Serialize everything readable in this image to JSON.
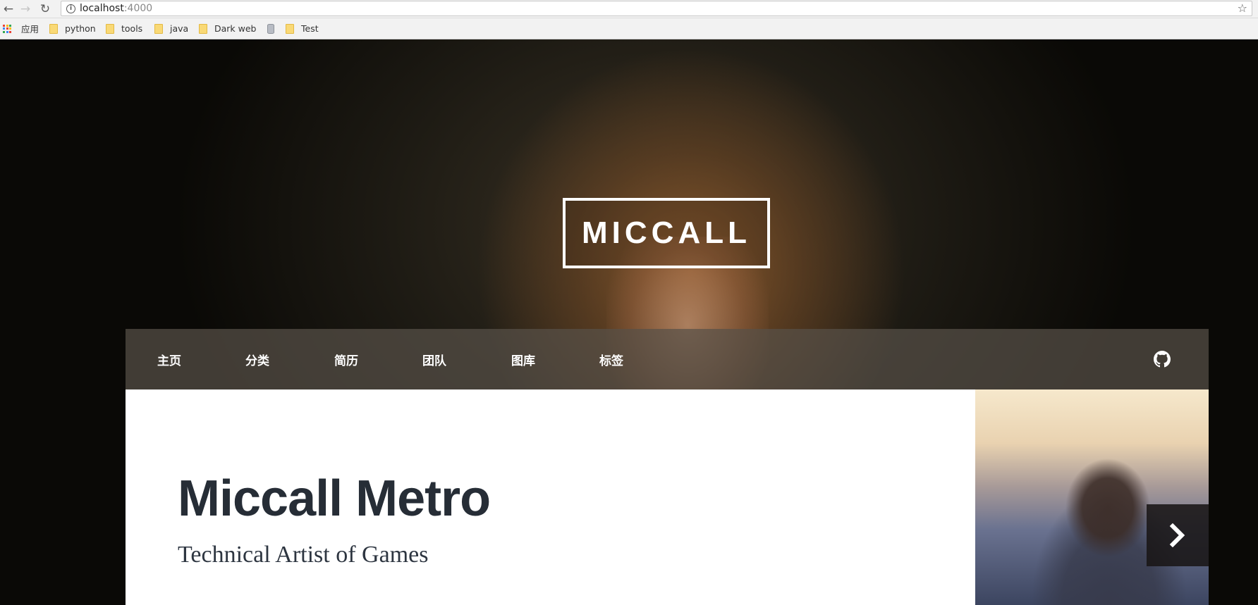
{
  "browser": {
    "url_host": "localhost",
    "url_port": ":4000",
    "bookmarks": [
      "应用",
      "python",
      "tools",
      "java",
      "Dark web",
      "Test"
    ]
  },
  "site": {
    "logo": "MICCALL",
    "nav": [
      "主页",
      "分类",
      "简历",
      "团队",
      "图库",
      "标签"
    ],
    "github_icon": "github-icon",
    "hero_title": "Miccall Metro",
    "hero_subtitle": "Technical Artist of Games",
    "next_icon": "chevron-right-icon"
  },
  "colors": {
    "title_text": "#262d36",
    "navbar_bg": "#585048",
    "card_bg": "#ffffff"
  }
}
